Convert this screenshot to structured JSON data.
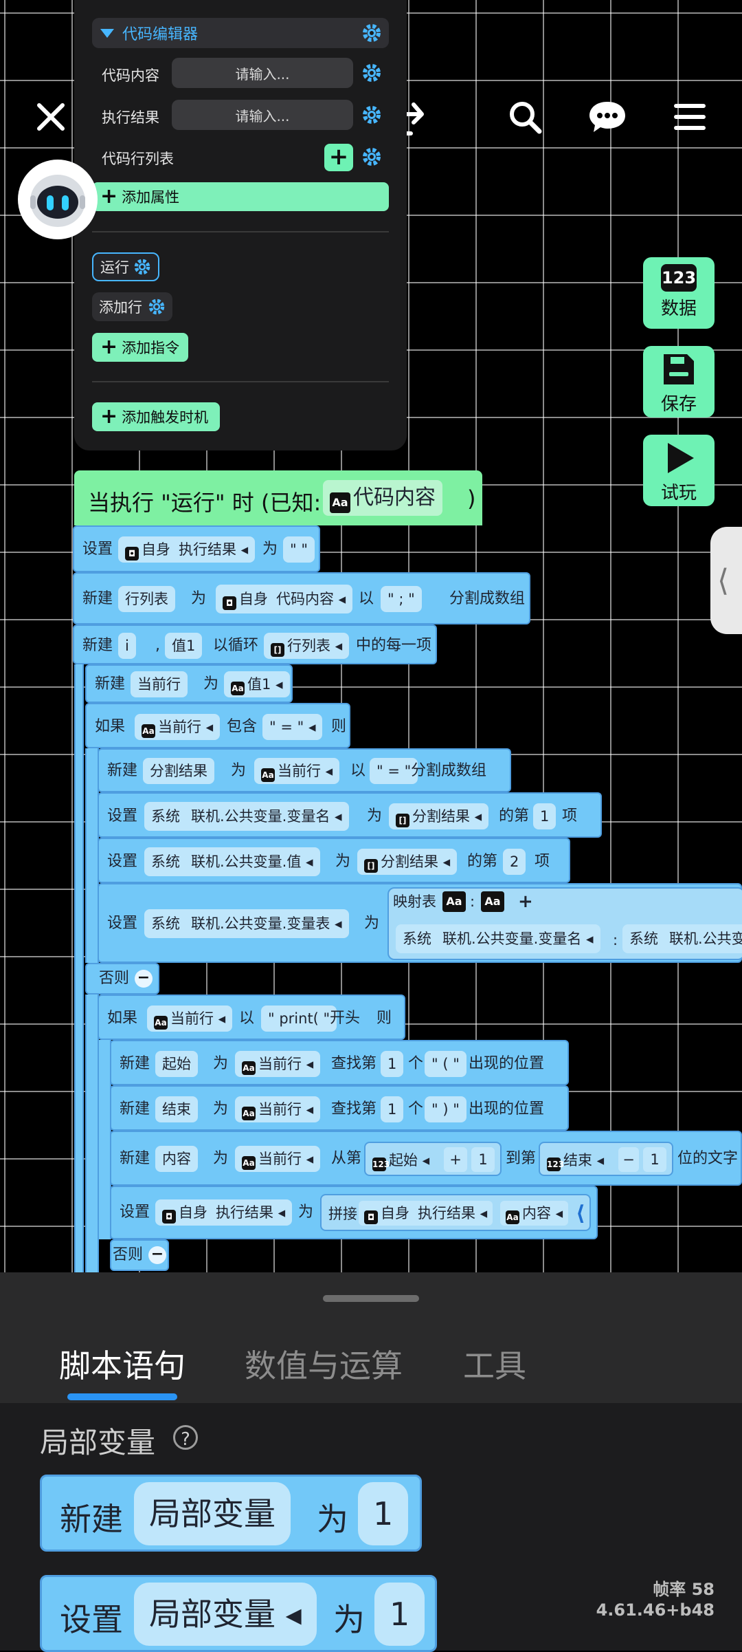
{
  "panel": {
    "header": "代码编辑器",
    "rows": [
      {
        "label": "代码内容",
        "placeholder": "请输入..."
      },
      {
        "label": "执行结果",
        "placeholder": "请输入..."
      },
      {
        "label": "代码行列表"
      }
    ],
    "add_property": "添加属性",
    "run_label": "运行",
    "add_row_label": "添加行",
    "add_instruction": "添加指令",
    "add_trigger": "添加触发时机"
  },
  "side_buttons": [
    {
      "label": "数据",
      "badge": "123"
    },
    {
      "label": "保存"
    },
    {
      "label": "试玩"
    }
  ],
  "script": {
    "hat_text": "当执行 \"运行\" 时 (已知:",
    "hat_param": "代码内容",
    "hat_close": ")",
    "words": {
      "set": "设置",
      "new": "新建",
      "as": "为",
      "self": "自身",
      "exec_result": "执行结果",
      "quote_empty": "\"  \"",
      "line_list": "行列表",
      "code_content": "代码内容",
      "by": "以",
      "semicolon": "\" ; \"",
      "split_array": "分割成数组",
      "i": "i",
      "comma": ",",
      "val1": "值1",
      "loop": "以循环",
      "each": "中的每一项",
      "cur_line": "当前行",
      "if": "如果",
      "contains": "包含",
      "eq_str": "\" = \"",
      "then": "则",
      "split_result": "分割结果",
      "system": "系统",
      "var_name": "联机.公共变量.变量名",
      "nth": "的第",
      "item": "项",
      "one": "1",
      "two": "2",
      "var_value": "联机.公共变量.值",
      "var_table": "联机.公共变量.变量表",
      "map_table": "映射表",
      "colon": ":",
      "plus": "+",
      "var_cut": "联机.公共变",
      "else": "否则",
      "minus": "−",
      "print": "\" print( \"",
      "starts": "开头",
      "start": "起始",
      "find_nth": "查找第",
      "ge": "个",
      "lparen": "\" ( \"",
      "rparen": "\" ) \"",
      "pos": "出现的位置",
      "end": "结束",
      "content": "内容",
      "from_nth": "从第",
      "to_nth": "到第",
      "chars": "位的文字",
      "join": "拼接"
    }
  },
  "bottom": {
    "tabs": [
      "脚本语句",
      "数值与运算",
      "工具"
    ],
    "section": "局部变量",
    "help": "?",
    "block1": {
      "kw": "新建",
      "var": "局部变量",
      "as": "为",
      "val": "1"
    },
    "block2": {
      "kw": "设置",
      "var": "局部变量",
      "as": "为",
      "val": "1"
    },
    "fps": "帧率 58",
    "version": "4.61.46+b48"
  }
}
